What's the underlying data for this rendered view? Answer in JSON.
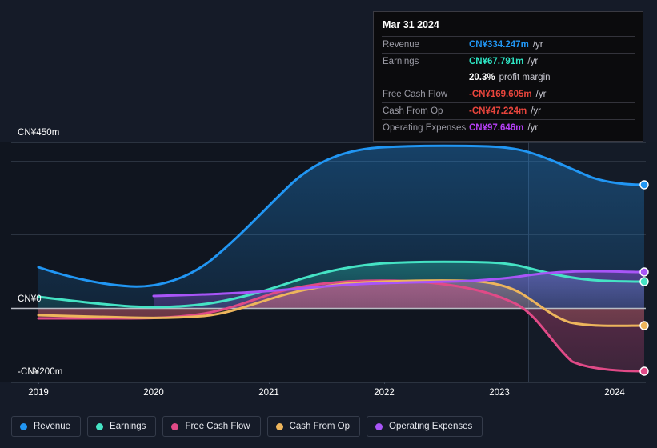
{
  "tooltip": {
    "date": "Mar 31 2024",
    "rows": [
      {
        "key": "Revenue",
        "value": "CN¥334.247m",
        "unit": "/yr",
        "color": "#2196f3"
      },
      {
        "key": "Earnings",
        "value": "CN¥67.791m",
        "unit": "/yr",
        "color": "#2ee6c5"
      },
      {
        "key": "",
        "value": "20.3%",
        "unit": "profit margin",
        "color": "#ffffff"
      },
      {
        "key": "Free Cash Flow",
        "value": "-CN¥169.605m",
        "unit": "/yr",
        "color": "#e8453c"
      },
      {
        "key": "Cash From Op",
        "value": "-CN¥47.224m",
        "unit": "/yr",
        "color": "#e8453c"
      },
      {
        "key": "Operating Expenses",
        "value": "CN¥97.646m",
        "unit": "/yr",
        "color": "#b43ff4"
      }
    ]
  },
  "legend": {
    "items": [
      {
        "label": "Revenue",
        "color": "#2196f3"
      },
      {
        "label": "Earnings",
        "color": "#45e3c4"
      },
      {
        "label": "Free Cash Flow",
        "color": "#e04a87"
      },
      {
        "label": "Cash From Op",
        "color": "#edb55c"
      },
      {
        "label": "Operating Expenses",
        "color": "#a855f7"
      }
    ]
  },
  "axes": {
    "y_ticks": [
      {
        "label": "CN¥450m",
        "value": 450
      },
      {
        "label": "CN¥0",
        "value": 0
      },
      {
        "label": "-CN¥200m",
        "value": -200
      }
    ],
    "x_ticks": [
      "2019",
      "2020",
      "2021",
      "2022",
      "2023",
      "2024"
    ]
  },
  "chart_data": {
    "type": "area",
    "title": "",
    "xlabel": "",
    "ylabel": "",
    "currency": "CN¥",
    "units": "millions",
    "ylim": [
      -200,
      450
    ],
    "grid": true,
    "legend_position": "bottom-left",
    "x": [
      "2019",
      "2019.5",
      "2020",
      "2020.5",
      "2021",
      "2021.5",
      "2022",
      "2022.5",
      "2023",
      "2023.5",
      "2024"
    ],
    "forecast_boundary": "2023.2",
    "series": [
      {
        "name": "Revenue",
        "color": "#2196f3",
        "values": [
          110,
          95,
          80,
          120,
          210,
          330,
          405,
          418,
          415,
          385,
          334
        ]
      },
      {
        "name": "Earnings",
        "color": "#45e3c4",
        "values": [
          30,
          18,
          8,
          2,
          10,
          55,
          110,
          128,
          127,
          100,
          68
        ]
      },
      {
        "name": "Free Cash Flow",
        "color": "#e04a87",
        "values": [
          -28,
          -27,
          -26,
          -26,
          -20,
          10,
          42,
          38,
          5,
          -120,
          -170
        ]
      },
      {
        "name": "Cash From Op",
        "color": "#edb55c",
        "values": [
          -20,
          -21,
          -22,
          -24,
          -10,
          30,
          58,
          60,
          48,
          -30,
          -47
        ]
      },
      {
        "name": "Operating Expenses",
        "color": "#a855f7",
        "values": [
          null,
          null,
          32,
          33,
          38,
          50,
          62,
          66,
          88,
          95,
          98
        ]
      }
    ]
  }
}
